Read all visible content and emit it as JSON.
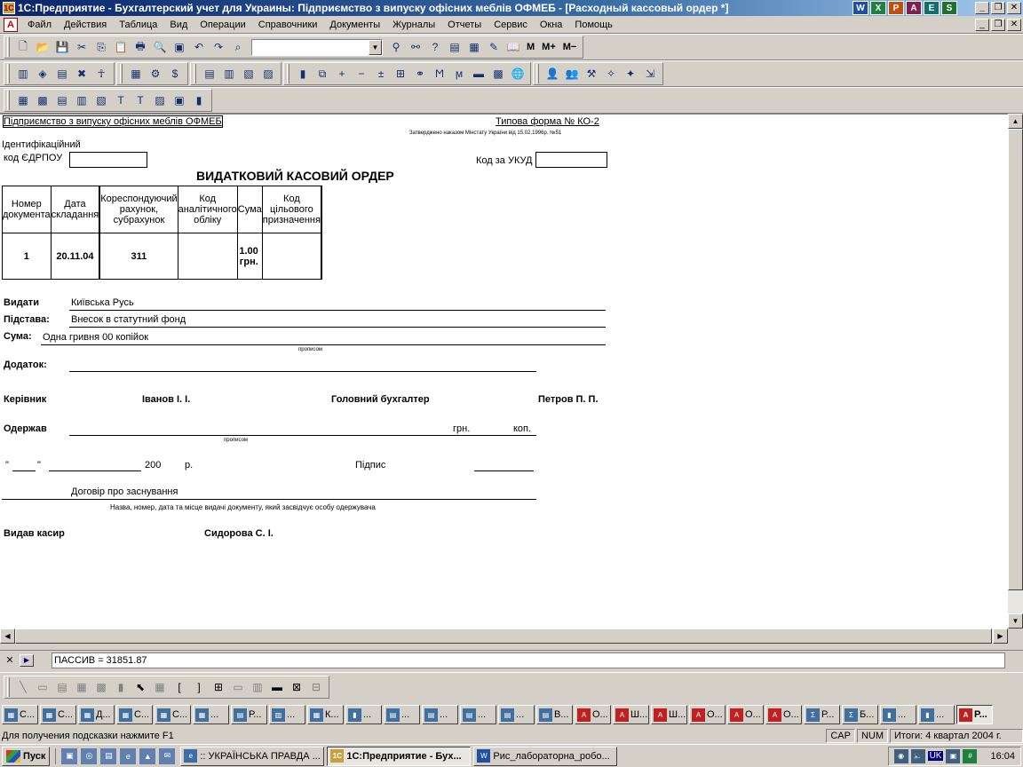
{
  "window": {
    "title": "1С:Предприятие - Бухгалтерский учет для Украины: Підприємство з випуску офісних меблів ОФМЕБ - [Расходный кассовый ордер  *]",
    "app_icons": [
      "W",
      "X",
      "P",
      "A",
      "E",
      "S"
    ]
  },
  "menu": [
    "Файл",
    "Действия",
    "Таблица",
    "Вид",
    "Операции",
    "Справочники",
    "Документы",
    "Журналы",
    "Отчеты",
    "Сервис",
    "Окна",
    "Помощь"
  ],
  "toolbar": {
    "memory_buttons": [
      "M",
      "M+",
      "M−"
    ],
    "combo_value": ""
  },
  "document": {
    "company": "Підприємство з випуску офісних меблів ОФМЕБ",
    "form_type": "Типова форма  № КО-2",
    "approval": "Затверджено наказом Мінстату України від 15.02.1996р. №51",
    "id_label_1": "Ідентифікаційний",
    "id_label_2": "код ЄДРПОУ",
    "ukud_label": "Код за УКУД",
    "title": "ВИДАТКОВИЙ КАСОВИЙ ОРДЕР",
    "table_headers": [
      "Номер документа",
      "Дата складання",
      "",
      "Кореспондуючий рахунок, субрахунок",
      "Код аналітичного обліку",
      "Сума",
      "Код цільового призначення",
      ""
    ],
    "table_row": [
      "1",
      "20.11.04",
      "",
      "311",
      "",
      "1.00 грн.",
      "",
      ""
    ],
    "issue_label": "Видати",
    "issue_value": "Київська Русь",
    "basis_label": "Підстава:",
    "basis_value": "Внесок в статутний фонд",
    "sum_label": "Сума:",
    "sum_value": "Одна гривня 00 копійок",
    "in_words": "прописом",
    "attachment_label": "Додаток:",
    "director_label": "Керівник",
    "director_name": "Іванов І. І.",
    "accountant_label": "Головний  бухгалтер",
    "accountant_name": "Петров П. П.",
    "received_label": "Одержав",
    "uah": "грн.",
    "kop": "коп.",
    "in_words_2": "прописом",
    "quote_open": "\"",
    "quote_close": "\"",
    "year": "200",
    "year_suffix": "р.",
    "signature": "Підпис",
    "id_document": "Договір про заснування",
    "id_document_caption": "Назва, номер, дата та місце видачі документу, який засвідчує особу одержувача",
    "cashier_label": "Видав касир",
    "cashier_name": "Сидорова С. І."
  },
  "formula": {
    "text": "ПАССИВ  = 31851.87"
  },
  "window_tabs": [
    {
      "label": "С..."
    },
    {
      "label": "С..."
    },
    {
      "label": "Д..."
    },
    {
      "label": "С..."
    },
    {
      "label": "С..."
    },
    {
      "label": "..."
    },
    {
      "label": "Р..."
    },
    {
      "label": "..."
    },
    {
      "label": "К..."
    },
    {
      "label": "..."
    },
    {
      "label": "..."
    },
    {
      "label": "..."
    },
    {
      "label": "..."
    },
    {
      "label": "..."
    },
    {
      "label": "В..."
    },
    {
      "label": "О..."
    },
    {
      "label": "Ш..."
    },
    {
      "label": "Ш..."
    },
    {
      "label": "О..."
    },
    {
      "label": "О..."
    },
    {
      "label": "О..."
    },
    {
      "label": "Р..."
    },
    {
      "label": "Б..."
    },
    {
      "label": "..."
    },
    {
      "label": "..."
    },
    {
      "label": "Р..."
    }
  ],
  "status": {
    "hint": "Для получения подсказки нажмите F1",
    "cap": "CAP",
    "num": "NUM",
    "period": "Итоги: 4 квартал 2004 г."
  },
  "taskbar": {
    "start": "Пуск",
    "tasks": [
      {
        "label": ":: УКРАЇНСЬКА ПРАВДА ..."
      },
      {
        "label": "1С:Предприятие - Бух..."
      },
      {
        "label": "Рис_лабораторна_робо..."
      }
    ],
    "lang": "UK",
    "clock": "16:04"
  }
}
